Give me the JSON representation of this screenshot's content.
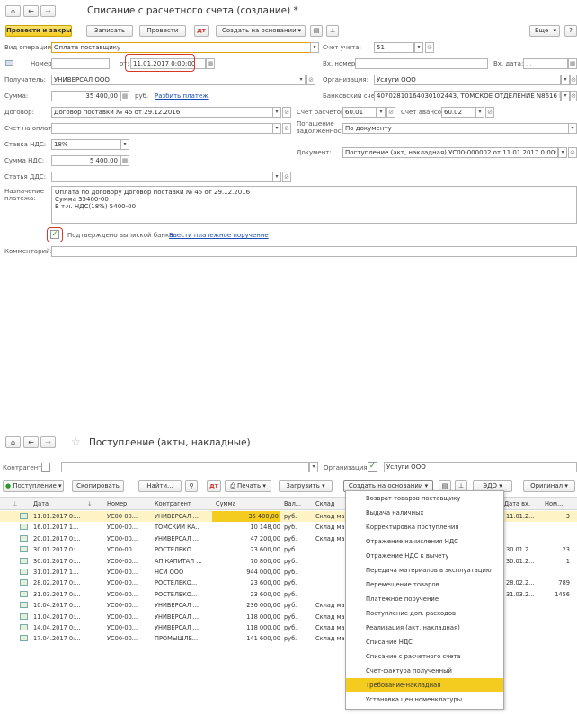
{
  "form": {
    "title": "Списание с расчетного счета (создание) *",
    "buttons": {
      "post_close": "Провести и закрыть",
      "save": "Записать",
      "post": "Провести",
      "create_basis": "Создать на основании",
      "more": "Еще",
      "help": "?"
    },
    "fields": {
      "op_type_label": "Вид операции:",
      "op_type": "Оплата поставщику",
      "account_label": "Счет учета:",
      "account": "51",
      "number_label": "Номер:",
      "number": "",
      "date_from_label": "от:",
      "date": "11.01.2017  0:00:00",
      "in_number_label": "Вх. номер:",
      "in_date_label": "Вх. дата:",
      "in_date": ". .",
      "recipient_label": "Получатель:",
      "recipient": "УНИВЕРСАЛ ООО",
      "org_label": "Организация:",
      "org": "Услуги ООО",
      "sum_label": "Сумма:",
      "sum": "35 400,00",
      "rub": "руб.",
      "split_link": "Разбить платеж",
      "bank_account_label": "Банковский счет:",
      "bank_account": "40702810164030102443, ТОМСКОЕ ОТДЕЛЕНИЕ N8616 ПАО СБ",
      "contract_label": "Договор:",
      "contract": "Договор поставки № 45 от 29.12.2016",
      "settle_acc_label": "Счет расчетов:",
      "settle_acc": "60.01",
      "advance_acc_label": "Счет авансов:",
      "advance_acc": "60.02",
      "invoice_label": "Счет на оплату:",
      "repay_label_1": "Погашение",
      "repay_label_2": "задолженности:",
      "repay": "По документу",
      "vat_rate_label": "Ставка НДС:",
      "vat_rate": "18%",
      "document_label": "Документ:",
      "document": "Поступление (акт, накладная) УС00-000002 от 11.01.2017 0:00:00",
      "vat_sum_label": "Сумма НДС:",
      "vat_sum": "5 400,00",
      "dds_label": "Статья ДДС:",
      "purpose_label_1": "Назначение",
      "purpose_label_2": "платежа:",
      "purpose_1": "Оплата по договору Договор поставки № 45 от 29.12.2016",
      "purpose_2": "Сумма 35400-00",
      "purpose_3": "В т.ч. НДС(18%) 5400-00",
      "confirmed_label": "Подтверждено выпиской банка:",
      "enter_order_link": "Ввести платежное поручение",
      "comment_label": "Комментарий:"
    }
  },
  "list": {
    "title": "Поступление (акты, накладные)",
    "contractor_label": "Контрагент:",
    "org_label": "Организация:",
    "org": "Услуги ООО",
    "buttons": {
      "receipt": "Поступление",
      "copy": "Скопировать",
      "find": "Найти...",
      "print": "Печать",
      "upload": "Загрузить",
      "create_basis": "Создать на основании",
      "edo": "ЭДО",
      "original": "Оригинал"
    },
    "columns": [
      "Дата",
      "Номер",
      "Контрагент",
      "Сумма",
      "Вал...",
      "Склад",
      "Дата вх.",
      "Ном..."
    ],
    "rows": [
      {
        "date": "11.01.2017 0:...",
        "num": "УС00-00...",
        "ctr": "УНИВЕРСАЛ ...",
        "sum": "35 400,00",
        "cur": "руб.",
        "wh": "Склад ма",
        "din": "11.01.2...",
        "nin": "3"
      },
      {
        "date": "16.01.2017 1...",
        "num": "УС00-00...",
        "ctr": "ТОМСКИЙ КА...",
        "sum": "10 148,00",
        "cur": "руб.",
        "wh": "Склад ма",
        "din": "",
        "nin": ""
      },
      {
        "date": "20.01.2017 0:...",
        "num": "УС00-00...",
        "ctr": "УНИВЕРСАЛ ...",
        "sum": "47 200,00",
        "cur": "руб.",
        "wh": "Склад ма",
        "din": "",
        "nin": ""
      },
      {
        "date": "30.01.2017 0:...",
        "num": "УС00-00...",
        "ctr": "РОСТЕЛЕКО...",
        "sum": "23 600,00",
        "cur": "руб.",
        "wh": "",
        "din": "30.01.2...",
        "nin": "23"
      },
      {
        "date": "30.01.2017 0:...",
        "num": "УС00-00...",
        "ctr": "АП КАПИТАЛ ...",
        "sum": "70 800,00",
        "cur": "руб.",
        "wh": "",
        "din": "30.01.2...",
        "nin": "1"
      },
      {
        "date": "31.01.2017 1...",
        "num": "УС00-00...",
        "ctr": "НСИ ООО",
        "sum": "944 000,00",
        "cur": "руб.",
        "wh": "",
        "din": "",
        "nin": ""
      },
      {
        "date": "28.02.2017 0:...",
        "num": "УС00-00...",
        "ctr": "РОСТЕЛЕКО...",
        "sum": "23 600,00",
        "cur": "руб.",
        "wh": "",
        "din": "28.02.2...",
        "nin": "789"
      },
      {
        "date": "31.03.2017 0:...",
        "num": "УС00-00...",
        "ctr": "РОСТЕЛЕКО...",
        "sum": "23 600,00",
        "cur": "руб.",
        "wh": "",
        "din": "31.03.2...",
        "nin": "1456"
      },
      {
        "date": "10.04.2017 0:...",
        "num": "УС00-00...",
        "ctr": "УНИВЕРСАЛ ...",
        "sum": "236 000,00",
        "cur": "руб.",
        "wh": "Склад ма",
        "din": "",
        "nin": ""
      },
      {
        "date": "11.04.2017 0:...",
        "num": "УС00-00...",
        "ctr": "УНИВЕРСАЛ ...",
        "sum": "118 000,00",
        "cur": "руб.",
        "wh": "Склад ма",
        "din": "",
        "nin": ""
      },
      {
        "date": "14.04.2017 0:...",
        "num": "УС00-00...",
        "ctr": "УНИВЕРСАЛ ...",
        "sum": "118 000,00",
        "cur": "руб.",
        "wh": "Склад ма",
        "din": "",
        "nin": ""
      },
      {
        "date": "17.04.2017 0:...",
        "num": "УС00-00...",
        "ctr": "ПРОМЫШЛЕ...",
        "sum": "141 600,00",
        "cur": "руб.",
        "wh": "Склад ма",
        "din": "",
        "nin": ""
      }
    ],
    "menu": [
      "Возврат товаров поставщику",
      "Выдача наличных",
      "Корректировка поступления",
      "Отражение начисления НДС",
      "Отражение НДС к вычету",
      "Передача материалов в эксплуатацию",
      "Перемещение товаров",
      "Платежное поручение",
      "Поступление доп. расходов",
      "Реализация (акт, накладная)",
      "Списание НДС",
      "Списание с расчетного счета",
      "Счет-фактура полученный",
      "Требование-накладная",
      "Установка цен номенклатуры"
    ]
  },
  "colors": {
    "accent_yellow": "#f4cc20",
    "highlight_red": "#d4392c",
    "link_blue": "#1c4cb5",
    "selected_row": "#fdf3c4"
  }
}
